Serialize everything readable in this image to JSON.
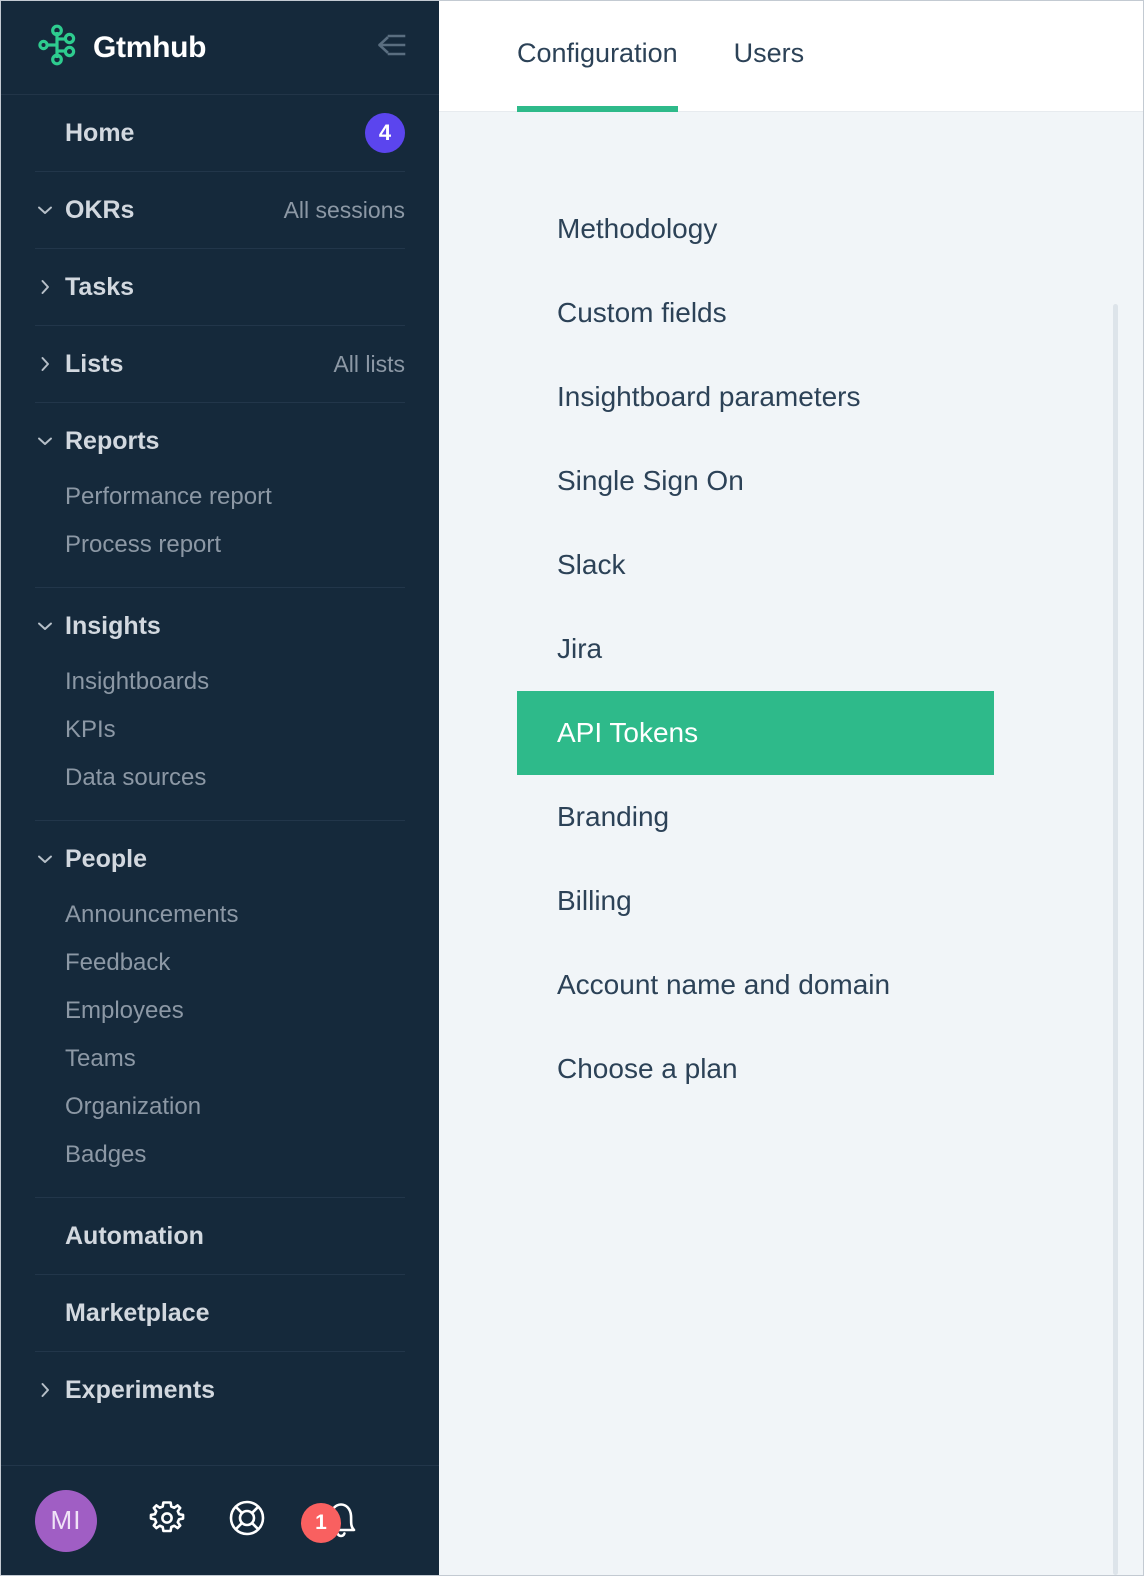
{
  "brand": {
    "name": "Gtmhub",
    "logo_icon": "gtmhub-node-logo-icon",
    "collapse_icon": "collapse-sidebar-arrow-icon"
  },
  "sidebar": {
    "groups": [
      {
        "label": "Home",
        "chevron": "none",
        "badge": "4",
        "aside": "",
        "children": []
      },
      {
        "label": "OKRs",
        "chevron": "down",
        "badge": "",
        "aside": "All sessions",
        "children": []
      },
      {
        "label": "Tasks",
        "chevron": "right",
        "badge": "",
        "aside": "",
        "children": []
      },
      {
        "label": "Lists",
        "chevron": "right",
        "badge": "",
        "aside": "All lists",
        "children": []
      },
      {
        "label": "Reports",
        "chevron": "down",
        "badge": "",
        "aside": "",
        "children": [
          "Performance report",
          "Process report"
        ]
      },
      {
        "label": "Insights",
        "chevron": "down",
        "badge": "",
        "aside": "",
        "children": [
          "Insightboards",
          "KPIs",
          "Data sources"
        ]
      },
      {
        "label": "People",
        "chevron": "down",
        "badge": "",
        "aside": "",
        "children": [
          "Announcements",
          "Feedback",
          "Employees",
          "Teams",
          "Organization",
          "Badges"
        ]
      },
      {
        "label": "Automation",
        "chevron": "none",
        "badge": "",
        "aside": "",
        "children": []
      },
      {
        "label": "Marketplace",
        "chevron": "none",
        "badge": "",
        "aside": "",
        "children": []
      },
      {
        "label": "Experiments",
        "chevron": "right",
        "badge": "",
        "aside": "",
        "children": []
      }
    ],
    "footer": {
      "avatar_initials": "MI",
      "settings_icon": "gear-icon",
      "help_icon": "lifebuoy-icon",
      "notifications_icon": "bell-icon",
      "notifications_count": "1"
    }
  },
  "main": {
    "tabs": [
      {
        "label": "Configuration",
        "active": true
      },
      {
        "label": "Users",
        "active": false
      }
    ],
    "settings_items": [
      {
        "label": "Methodology",
        "active": false
      },
      {
        "label": "Custom fields",
        "active": false
      },
      {
        "label": "Insightboard parameters",
        "active": false
      },
      {
        "label": "Single Sign On",
        "active": false
      },
      {
        "label": "Slack",
        "active": false
      },
      {
        "label": "Jira",
        "active": false
      },
      {
        "label": "API Tokens",
        "active": true
      },
      {
        "label": "Branding",
        "active": false
      },
      {
        "label": "Billing",
        "active": false
      },
      {
        "label": "Account name and domain",
        "active": false
      },
      {
        "label": "Choose a plan",
        "active": false
      }
    ]
  },
  "colors": {
    "sidebar_bg": "#15293b",
    "accent_green": "#2eba8a",
    "badge_purple": "#5b45ee",
    "badge_red": "#f96060",
    "avatar_purple": "#a05ec4",
    "content_bg": "#f1f5f8",
    "text_dark": "#2c4257"
  }
}
